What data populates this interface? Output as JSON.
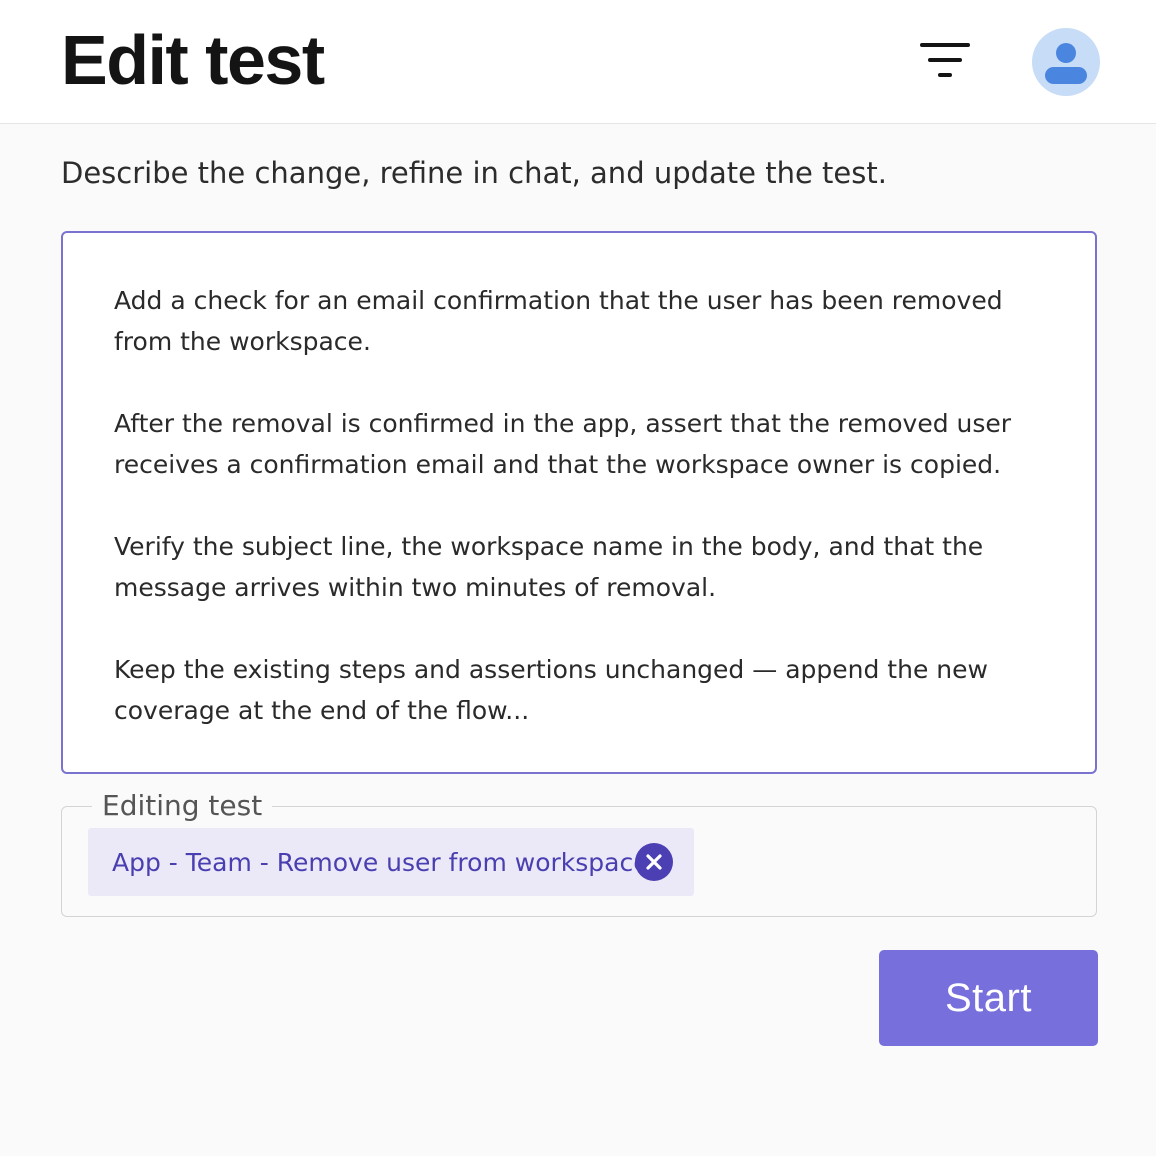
{
  "header": {
    "title": "Edit test",
    "filter_icon": "filter-icon",
    "avatar_icon": "user-icon",
    "avatar_bg": "#c7dcf6",
    "avatar_fg": "#4a86e0"
  },
  "main": {
    "subtitle": "Describe the change, refine in chat, and update the test.",
    "prompt": {
      "paragraphs": [
        "Add a check for an email confirmation that the user has been removed from the workspace.",
        "After the removal is confirmed in the app, assert that the removed user receives a confirmation email and that the workspace owner is copied.",
        "Verify the subject line, the workspace name in the body, and that the message arrives within two minutes of removal.",
        "Keep the existing steps and assertions unchanged — append the new coverage at the end of the flow..."
      ],
      "border_color": "#7a72cf"
    },
    "editing": {
      "legend": "Editing test",
      "chip_label": "App - Team - Remove user from workspace",
      "remove_icon": "close-icon"
    },
    "start_label": "Start"
  },
  "colors": {
    "accent": "#766fdc",
    "chip_bg": "#ebe9f7",
    "chip_text": "#4a3fb0"
  }
}
